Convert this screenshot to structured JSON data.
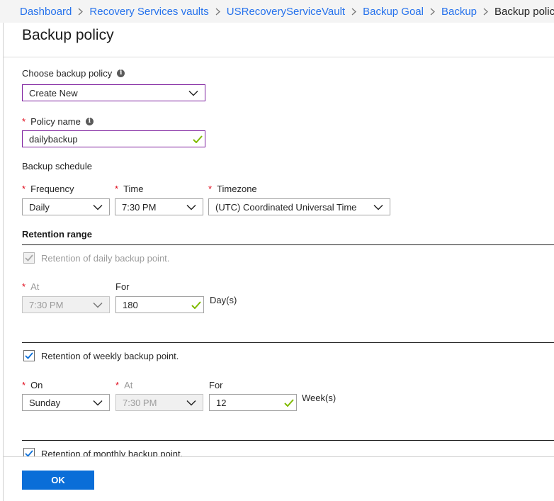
{
  "breadcrumb": {
    "items": [
      {
        "label": "Dashboard"
      },
      {
        "label": "Recovery Services vaults"
      },
      {
        "label": "USRecoveryServiceVault"
      },
      {
        "label": "Backup Goal"
      },
      {
        "label": "Backup"
      },
      {
        "label": "Backup policy"
      }
    ]
  },
  "blade": {
    "title": "Backup policy"
  },
  "form": {
    "choose_policy": {
      "label": "Choose backup policy",
      "value": "Create New"
    },
    "policy_name": {
      "label": "Policy name",
      "value": "dailybackup"
    },
    "schedule": {
      "heading": "Backup schedule",
      "frequency": {
        "label": "Frequency",
        "value": "Daily"
      },
      "time": {
        "label": "Time",
        "value": "7:30 PM"
      },
      "timezone": {
        "label": "Timezone",
        "value": "(UTC) Coordinated Universal Time"
      }
    },
    "retention": {
      "heading": "Retention range",
      "daily": {
        "label": "Retention of daily backup point.",
        "checked": true,
        "disabled": true,
        "at_label": "At",
        "at_value": "7:30 PM",
        "for_label": "For",
        "for_value": "180",
        "unit": "Day(s)"
      },
      "weekly": {
        "label": "Retention of weekly backup point.",
        "checked": true,
        "on_label": "On",
        "on_value": "Sunday",
        "at_label": "At",
        "at_value": "7:30 PM",
        "for_label": "For",
        "for_value": "12",
        "unit": "Week(s)"
      },
      "monthly": {
        "label": "Retention of monthly backup point.",
        "checked": true
      }
    }
  },
  "footer": {
    "ok_label": "OK"
  },
  "colors": {
    "accent": "#0a6ed8",
    "link": "#2672ec",
    "valid_border": "#7d1e9e",
    "valid_tick": "#7fba00",
    "required_star": "#e00b1c"
  }
}
